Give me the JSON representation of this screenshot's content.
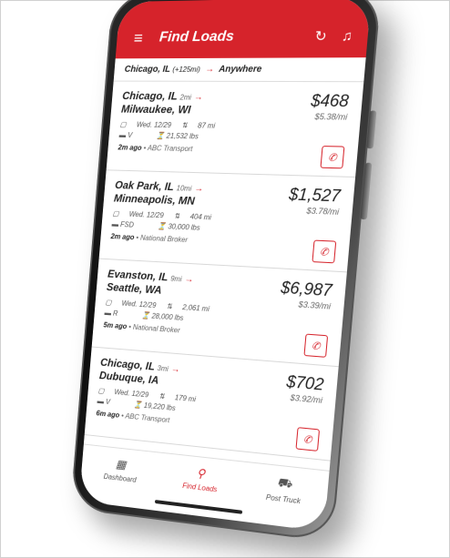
{
  "appbar": {
    "title": "Find Loads",
    "menu_icon": "menu-icon",
    "refresh_icon": "refresh-icon",
    "alert_icon": "bell-icon"
  },
  "route": {
    "origin": "Chicago, IL",
    "radius": "(+125mi)",
    "destination": "Anywhere"
  },
  "loads": [
    {
      "origin": "Chicago, IL",
      "origin_mi": "2mi",
      "destination": "Milwaukee, WI",
      "date": "Wed. 12/29",
      "distance": "87 mi",
      "equip": "V",
      "weight": "21,532 lbs",
      "ago": "2m ago",
      "broker": "ABC Transport",
      "total": "$468",
      "rate": "$5.38/mi"
    },
    {
      "origin": "Oak Park, IL",
      "origin_mi": "10mi",
      "destination": "Minneapolis, MN",
      "date": "Wed. 12/29",
      "distance": "404 mi",
      "equip": "FSD",
      "weight": "30,000 lbs",
      "ago": "2m ago",
      "broker": "National Broker",
      "total": "$1,527",
      "rate": "$3.78/mi"
    },
    {
      "origin": "Evanston, IL",
      "origin_mi": "9mi",
      "destination": "Seattle, WA",
      "date": "Wed. 12/29",
      "distance": "2,061 mi",
      "equip": "R",
      "weight": "28,000 lbs",
      "ago": "5m ago",
      "broker": "National Broker",
      "total": "$6,987",
      "rate": "$3.39/mi"
    },
    {
      "origin": "Chicago, IL",
      "origin_mi": "3mi",
      "destination": "Dubuque, IA",
      "date": "Wed. 12/29",
      "distance": "179 mi",
      "equip": "V",
      "weight": "19,220 lbs",
      "ago": "6m ago",
      "broker": "ABC Transport",
      "total": "$702",
      "rate": "$3.92/mi"
    }
  ],
  "tabs": [
    {
      "label": "Dashboard",
      "icon": "dashboard-icon"
    },
    {
      "label": "Find Loads",
      "icon": "search-icon"
    },
    {
      "label": "Post Truck",
      "icon": "truck-icon"
    }
  ],
  "colors": {
    "brand": "#d6232b"
  }
}
